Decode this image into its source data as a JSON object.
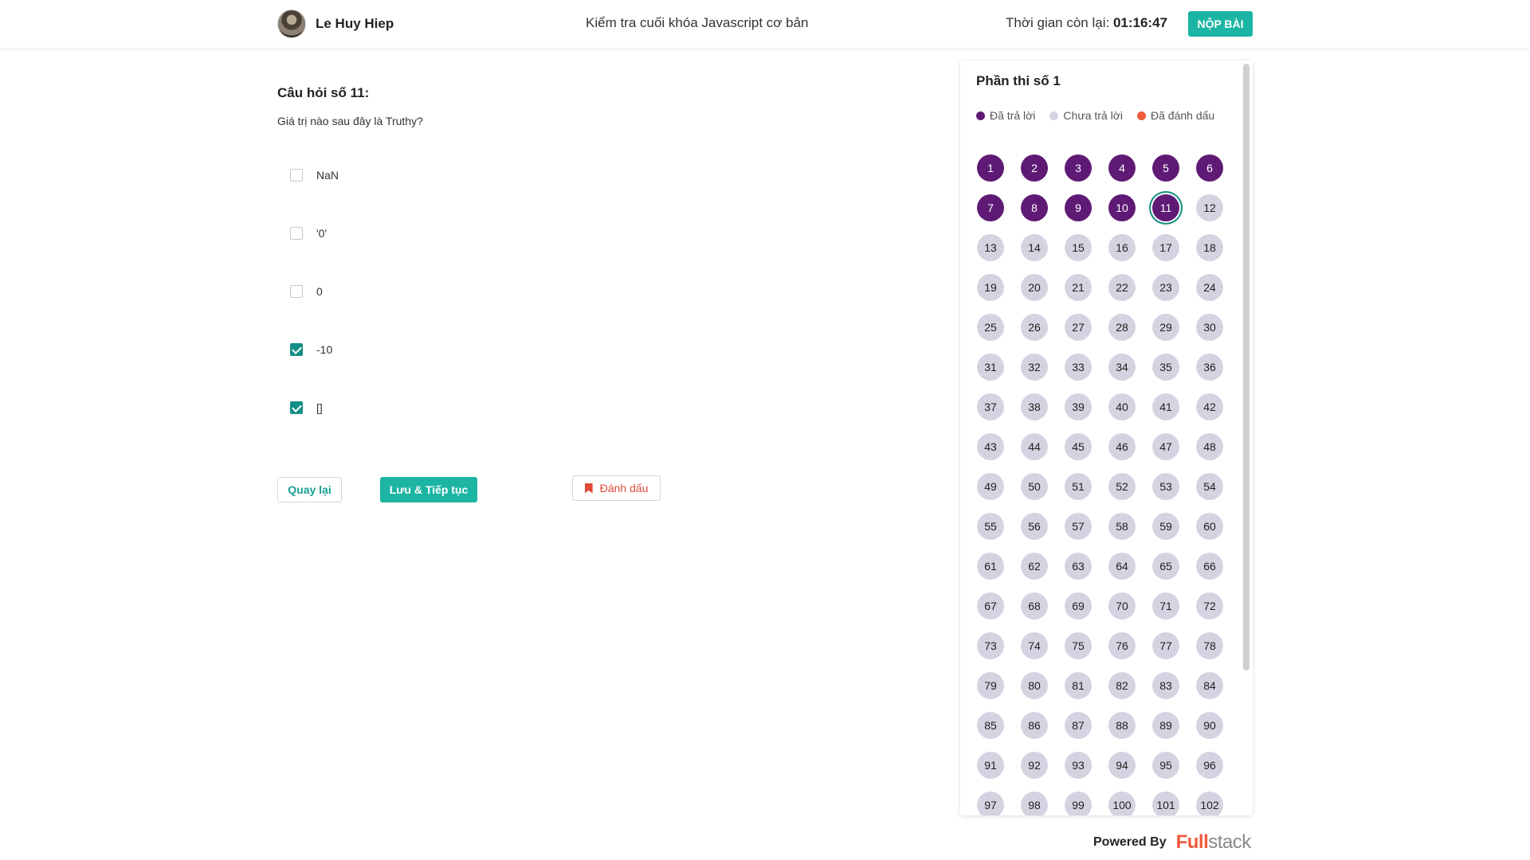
{
  "header": {
    "user_name": "Le Huy Hiep",
    "exam_title": "Kiểm tra cuối khóa Javascript cơ bản",
    "timer_label": "Thời gian còn lại: ",
    "timer_value": "01:16:47",
    "submit_label": "NỘP BÀI"
  },
  "question": {
    "title": "Câu hỏi số 11:",
    "text": "Giá trị nào sau đây là Truthy?",
    "options": [
      {
        "label": "NaN",
        "checked": false
      },
      {
        "label": "'0'",
        "checked": false
      },
      {
        "label": "0",
        "checked": false
      },
      {
        "label": "-10",
        "checked": true
      },
      {
        "label": "[]",
        "checked": true
      }
    ]
  },
  "actions": {
    "back_label": "Quay lại",
    "save_label": "Lưu & Tiếp tục",
    "mark_label": "Đánh dấu"
  },
  "panel": {
    "title": "Phần thi số 1",
    "legend": {
      "answered": "Đã trả lời",
      "unanswered": "Chưa trả lời",
      "marked": "Đã đánh dấu"
    },
    "colors": {
      "answered": "#5f1a75",
      "unanswered": "#d7d2e1",
      "marked": "#ef5a3c",
      "accent": "#1cb5a3"
    },
    "total_visible": 102,
    "answered_count": 11,
    "current_question": 11
  },
  "footer": {
    "powered_label": "Powered By",
    "brand_part1": "Full",
    "brand_part2": "stack"
  }
}
